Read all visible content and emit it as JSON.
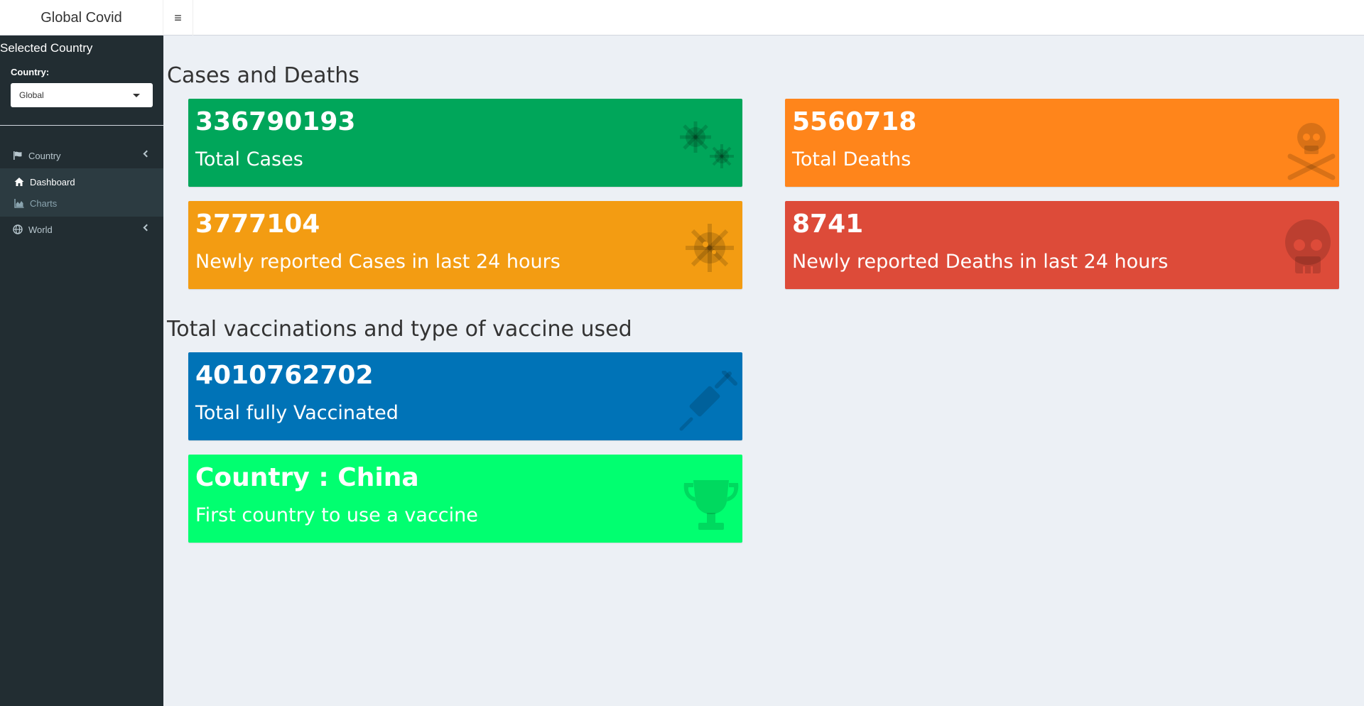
{
  "app": {
    "title": "Global Covid",
    "menu_toggle_icon": "hamburger-icon"
  },
  "sidebar": {
    "title": "Selected Country",
    "country_label": "Country:",
    "country_value": "Global",
    "menu": {
      "country": {
        "label": "Country",
        "icon": "flag-icon"
      },
      "dashboard": {
        "label": "Dashboard",
        "icon": "home-icon"
      },
      "charts": {
        "label": "Charts",
        "icon": "area-chart-icon"
      },
      "world": {
        "label": "World",
        "icon": "globe-icon"
      }
    }
  },
  "sections": {
    "cases_deaths": {
      "title": "Cases and Deaths"
    },
    "vaccinations": {
      "title": "Total vaccinations and type of vaccine used"
    }
  },
  "boxes": {
    "total_cases": {
      "value": "336790193",
      "label": "Total Cases",
      "color": "#00a65a",
      "icon": "virus-icon"
    },
    "total_deaths": {
      "value": "5560718",
      "label": "Total Deaths",
      "color": "#ff851b",
      "icon": "skull-crossbones-icon"
    },
    "new_cases": {
      "value": "3777104",
      "label": "Newly reported Cases in last 24 hours",
      "color": "#f39c12",
      "icon": "virus-icon"
    },
    "new_deaths": {
      "value": "8741",
      "label": "Newly reported Deaths in last 24 hours",
      "color": "#dd4b39",
      "icon": "skull-icon"
    },
    "vaccinated": {
      "value": "4010762702",
      "label": "Total fully Vaccinated",
      "color": "#0073b7",
      "icon": "syringe-icon"
    },
    "first_country": {
      "value": "Country : China",
      "label": "First country to use a vaccine",
      "color": "#01ff70",
      "icon": "trophy-icon"
    }
  }
}
